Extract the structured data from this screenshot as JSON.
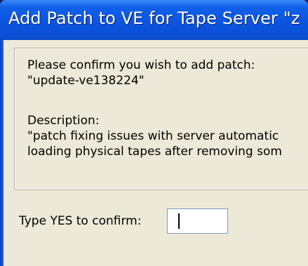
{
  "dialog": {
    "title": "Add Patch to VE for Tape Server \"z",
    "message": {
      "confirm_prompt": "Please confirm you wish to add patch:",
      "patch_name": "\"update-ve138224\"",
      "description_label": "Description:",
      "description_line1": "\"patch fixing issues with server automatic",
      "description_line2": "loading physical tapes after removing som"
    },
    "confirm": {
      "label": "Type YES to confirm:",
      "value": ""
    }
  }
}
